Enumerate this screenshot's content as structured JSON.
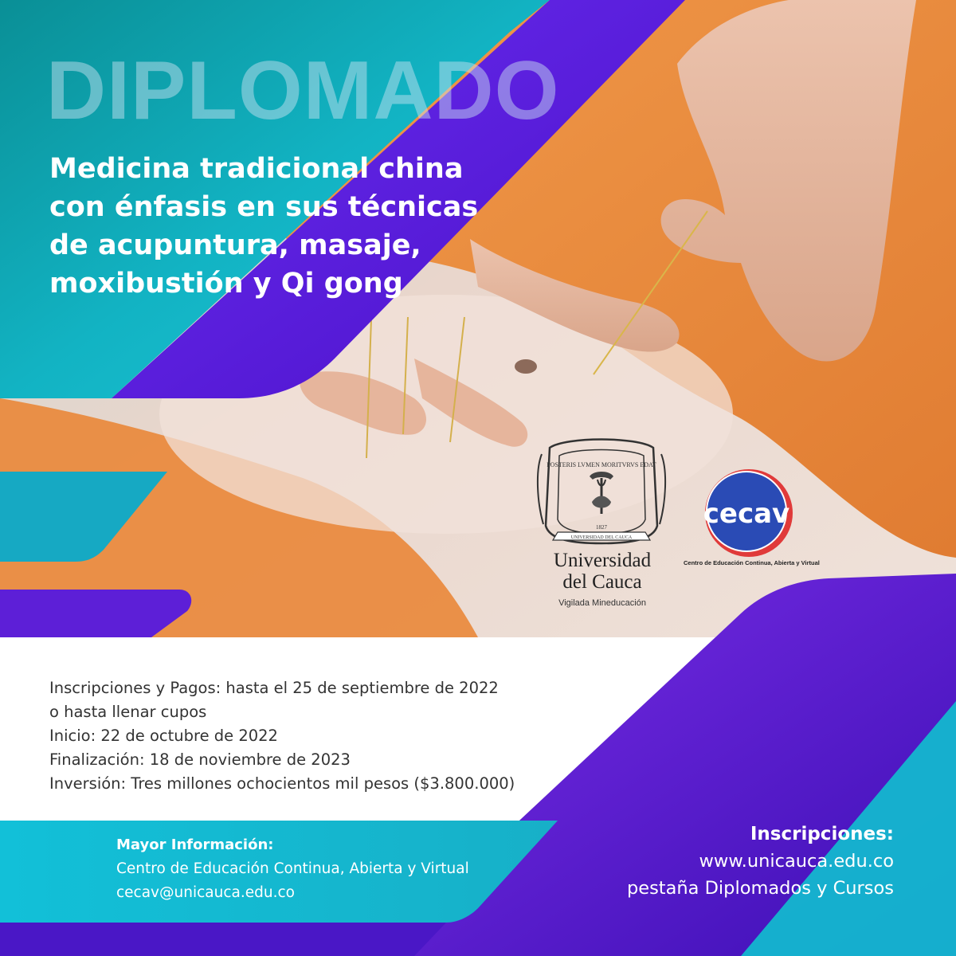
{
  "headline": "DIPLOMADO",
  "title_lines": [
    "Medicina tradicional china",
    "con énfasis en sus técnicas",
    "de acupuntura, masaje,",
    "moxibustión y Qi gong"
  ],
  "logos": {
    "unicauca": {
      "name_line1": "Universidad",
      "name_line2": "del Cauca",
      "tagline": "Vigilada Mineducación",
      "seal_motto": "POSTERIS LVMEN MORITVRVS EDAT",
      "seal_year": "1827",
      "seal_banner": "UNIVERSIDAD DEL CAUCA"
    },
    "cecav": {
      "mark_letters": "cecav",
      "caption": "Centro de Educación Continua, Abierta y Virtual"
    }
  },
  "details": [
    "Inscripciones y Pagos:  hasta el 25 de septiembre de 2022",
    "o hasta llenar cupos",
    "Inicio: 22 de octubre de 2022",
    "Finalización: 18 de noviembre de 2023",
    "Inversión: Tres millones ochocientos mil pesos ($3.800.000)"
  ],
  "contact": {
    "heading": "Mayor Información:",
    "org": "Centro de Educación Continua, Abierta y Virtual",
    "email": "cecav@unicauca.edu.co"
  },
  "signup": {
    "heading": "Inscripciones:",
    "url": "www.unicauca.edu.co",
    "note": "pestaña Diplomados y Cursos"
  },
  "colors": {
    "teal": "#0fb8cf",
    "purple": "#5a18d8",
    "violet": "#6a1fd6",
    "towel_orange": "#e58a3f",
    "skin": "#e8c7b4"
  }
}
